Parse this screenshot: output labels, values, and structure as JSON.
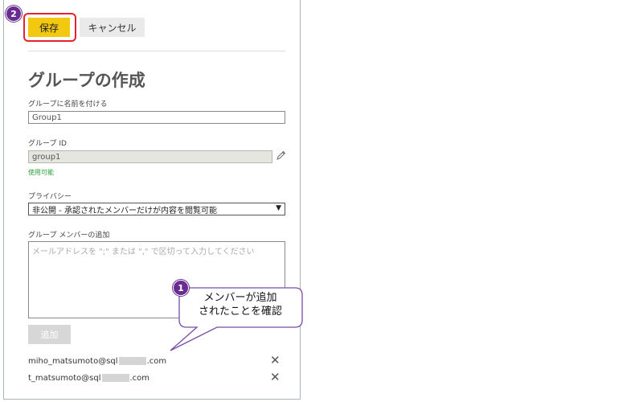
{
  "toolbar": {
    "save_label": "保存",
    "cancel_label": "キャンセル",
    "save_step_badge": "2"
  },
  "form": {
    "title": "グループの作成",
    "group_name": {
      "label": "グループに名前を付ける",
      "value": "Group1"
    },
    "group_id": {
      "label": "グループ ID",
      "value": "group1",
      "status": "使用可能"
    },
    "privacy": {
      "label": "プライバシー",
      "selected": "非公開 - 承認されたメンバーだけが内容を閲覧可能"
    },
    "members": {
      "label": "グループ メンバーの追加",
      "placeholder": "メールアドレスを \";\" または \",\" で区切って入力してください",
      "add_label": "追加",
      "list": [
        {
          "prefix": "miho_matsumoto@sql",
          "suffix": ".com"
        },
        {
          "prefix": "t_matsumoto@sql",
          "suffix": ".com"
        }
      ]
    }
  },
  "callout": {
    "step_badge": "1",
    "line1": "メンバーが追加",
    "line2": "されたことを確認"
  },
  "colors": {
    "accent_save": "#f2c811",
    "highlight": "#e8212e",
    "step_badge": "#6b2c91",
    "available": "#2a9d3a"
  },
  "icons": {
    "edit": "pencil-icon",
    "remove": "close-icon",
    "dropdown": "chevron-down-icon"
  }
}
